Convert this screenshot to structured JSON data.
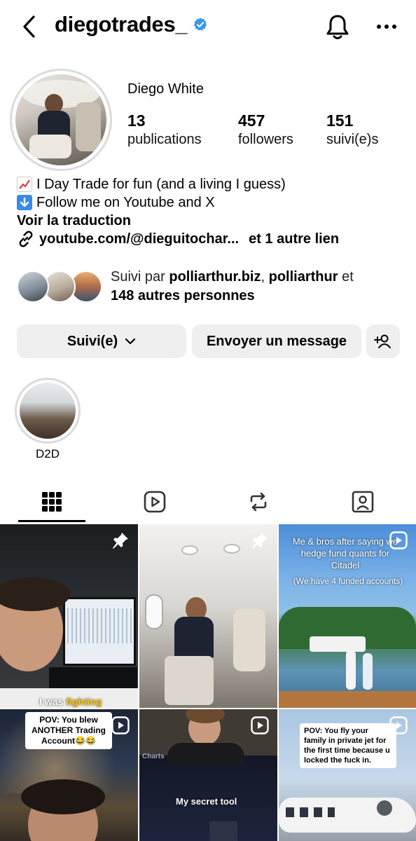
{
  "header": {
    "username": "diegotrades_",
    "verified": true,
    "icons": [
      "back-chevron-icon",
      "verified-badge-icon",
      "bell-icon",
      "more-icon"
    ]
  },
  "profile": {
    "display_name": "Diego White",
    "stats": [
      {
        "value": "13",
        "label": "publications"
      },
      {
        "value": "457",
        "label": "followers"
      },
      {
        "value": "151",
        "label": "suivi(e)s"
      }
    ],
    "bio": {
      "line1": "I Day Trade for fun (and a living I guess)",
      "line2": "Follow me on Youtube and X",
      "translate": "Voir la traduction",
      "link": "youtube.com/@dieguitochar...",
      "link_more": "et 1 autre lien"
    },
    "followed_by": {
      "prefix": "Suivi par",
      "user1": "polliarthur.biz",
      "separator": ",",
      "user2": "polliarthur",
      "conj": "et",
      "others": "148 autres personnes"
    }
  },
  "actions": {
    "follow_label": "Suivi(e)",
    "message_label": "Envoyer un message"
  },
  "highlights": [
    {
      "label": "D2D"
    }
  ],
  "tabs": [
    "grid-icon",
    "reels-icon",
    "reposts-icon",
    "tagged-icon"
  ],
  "posts": [
    {
      "caption": "I was fighting",
      "pinned": true
    },
    {
      "caption": "",
      "pinned": true
    },
    {
      "caption_top": "Me & bros after saying we hedge fund quants for Citadel",
      "caption_sub": "(We have 4 funded accounts)",
      "reel": true
    },
    {
      "caption": "POV: You blew ANOTHER Trading Account😂😂",
      "reel": true
    },
    {
      "caption": "My secret tool",
      "overlay_small": "Charts",
      "reel": true
    },
    {
      "caption": "POV: You fly your family in private jet for the first time because u locked the fuck in.",
      "reel": true
    }
  ],
  "colors": {
    "verified": "#3897f0",
    "button_bg": "#efefef",
    "ring": "#dbdbdb",
    "highlight_word": "#f2c200"
  }
}
